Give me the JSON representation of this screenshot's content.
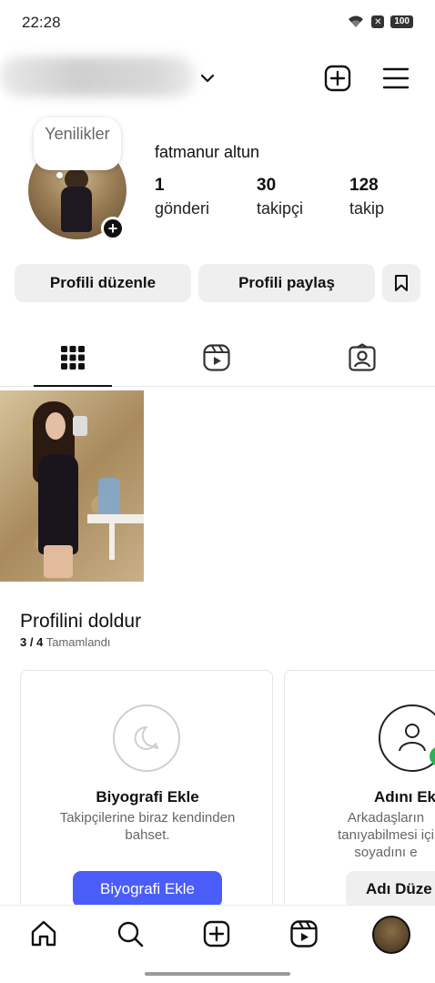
{
  "status_bar": {
    "time": "22:28",
    "battery": "100"
  },
  "profile": {
    "full_name": "fatmanur altun",
    "note": "Yenilikler",
    "stats": [
      {
        "value": "1",
        "label": "gönderi"
      },
      {
        "value": "30",
        "label": "takipçi"
      },
      {
        "value": "128",
        "label": "takip"
      }
    ]
  },
  "actions": {
    "edit_profile": "Profili düzenle",
    "share_profile": "Profili paylaş"
  },
  "complete_profile": {
    "title": "Profilini doldur",
    "progress": "3 / 4",
    "progress_label": "Tamamlandı",
    "cards": [
      {
        "title": "Biyografi Ekle",
        "text": "Takipçilerine biraz kendinden bahset.",
        "button": "Biyografi Ekle"
      },
      {
        "title": "Adını Ek",
        "text": "Arkadaşların tanıyabilmesi içi soyadını e",
        "button": "Adı Düze"
      }
    ]
  },
  "icons": {
    "header": [
      "chevron-down-icon",
      "create-plus-icon",
      "menu-icon"
    ],
    "tabs": [
      "grid-icon",
      "reels-icon",
      "tagged-icon"
    ],
    "nav": [
      "home-icon",
      "search-icon",
      "create-icon",
      "reels-icon",
      "profile-avatar"
    ]
  },
  "colors": {
    "primary_button": "#4a5df9",
    "secondary_button": "#efefef",
    "text": "#111111",
    "muted": "#666666"
  }
}
